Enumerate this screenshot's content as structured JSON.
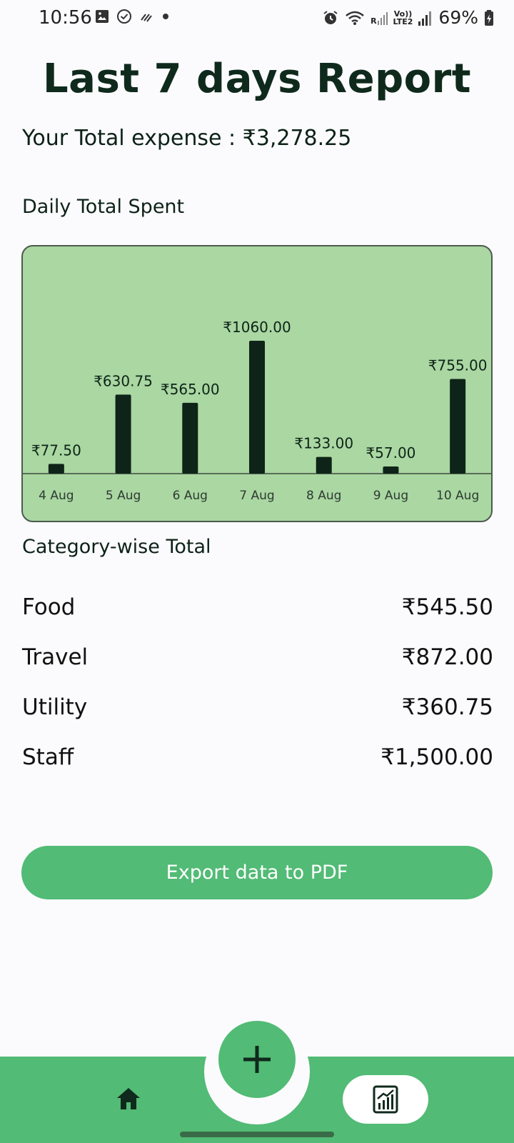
{
  "status_bar": {
    "time": "10:56",
    "battery": "69%",
    "network_r": "R",
    "network_volte": "Vo))",
    "network_lte": "LTE2"
  },
  "page": {
    "title": "Last 7 days Report",
    "total_expense": "Your Total expense : ₹3,278.25",
    "daily_label": "Daily Total Spent",
    "category_label": "Category-wise Total"
  },
  "chart_data": {
    "type": "bar",
    "categories": [
      "4 Aug",
      "5 Aug",
      "6 Aug",
      "7 Aug",
      "8 Aug",
      "9 Aug",
      "10 Aug"
    ],
    "values": [
      77.5,
      630.75,
      565.0,
      1060.0,
      133.0,
      57.0,
      755.0
    ],
    "value_labels": [
      "₹77.50",
      "₹630.75",
      "₹565.00",
      "₹1060.00",
      "₹133.00",
      "₹57.00",
      "₹755.00"
    ],
    "colors": {
      "background": "#aad7a2",
      "bar": "#0e2418"
    }
  },
  "categories": [
    {
      "name": "Food",
      "value": "₹545.50"
    },
    {
      "name": "Travel",
      "value": "₹872.00"
    },
    {
      "name": "Utility",
      "value": "₹360.75"
    },
    {
      "name": "Staff",
      "value": "₹1,500.00"
    }
  ],
  "actions": {
    "export_label": "Export data to PDF"
  },
  "nav": {
    "home_icon": "home-icon",
    "add_icon": "plus-icon",
    "report_icon": "report-chart-icon"
  },
  "colors": {
    "accent": "#52bb75",
    "dark": "#0f2a1c",
    "chart_bg": "#aad7a2"
  }
}
